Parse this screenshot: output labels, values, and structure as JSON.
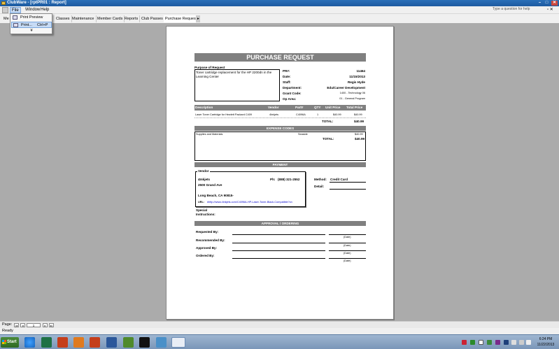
{
  "window": {
    "title": "ClubWare - [rptPR01 : Report]"
  },
  "menu": {
    "items": [
      "File",
      "Window",
      "Help"
    ],
    "help_placeholder": "Type a question for help"
  },
  "file_menu": {
    "print_preview": "Print Preview",
    "print": "Print...",
    "print_shortcut": "Ctrl+P",
    "more": "¥"
  },
  "tabs": [
    "Me",
    "Classes",
    "Maintenance",
    "Member Cards",
    "Reports",
    "Club Passes",
    "Purchase Request"
  ],
  "report": {
    "title": "PURCHASE REQUEST",
    "purpose_label": "Purpose of Request",
    "purpose_text": "Toner cartridge replacement for the HP 2200dn in the Learning Center",
    "fields": [
      {
        "label": "PR#:",
        "value": "11464"
      },
      {
        "label": "Date:",
        "value": "11/15/2013"
      },
      {
        "label": "Staff:",
        "value": "Regis Hyde"
      },
      {
        "label": "Department:",
        "value": "Edu/Career Development"
      },
      {
        "label": "Grant Code:",
        "value": "1400 - Technology 06"
      },
      {
        "label": "Op Area:",
        "value": "01 - General Program"
      }
    ],
    "item_headers": [
      "Description",
      "Vendor",
      "Part#",
      "QTY",
      "Unit Price",
      "Total Price"
    ],
    "items": [
      {
        "description": "Laser Toner Cartridge for Hewlett Packard C409",
        "vendor": "4Inkjets",
        "part": "C4096A",
        "qty": "1",
        "unit": "$40.99",
        "total": "$40.99"
      }
    ],
    "item_total_label": "TOTAL:",
    "item_total": "$40.99",
    "expense_header": "EXPENSE CODES",
    "expense_rows": [
      {
        "code": "Supplies and Materials",
        "area": "Seaside",
        "amount": "$40.99"
      }
    ],
    "expense_total_label": "TOTAL:",
    "expense_total": "$40.99",
    "payment_header": "PAYMENT",
    "vendor_label": "Vendor",
    "vendor_name": "4Inkjets",
    "vendor_phone_label": "Ph:",
    "vendor_phone": "(888) 321-2552",
    "vendor_addr1": "2500 Grand Ave",
    "vendor_addr2": "Long Beach, CA  90815-",
    "vendor_url_label": "URL:",
    "vendor_url": "#http://www.4inkjets.com/C4096A-HP-Laser-Toner-Black-Compatible?cn",
    "method_label": "Method:",
    "method": "Credit Card",
    "detail_label": "Detail:",
    "special_label": "Special Instructions:",
    "approval_header": "APPROVAL / ORDERING",
    "approval_rows": [
      "Requested By:",
      "Recommended By:",
      "Approved By:",
      "Ordered By:"
    ],
    "date_caption": "(Date)"
  },
  "pagenav": {
    "label": "Page:",
    "page": "1"
  },
  "status": {
    "text": "Ready"
  },
  "taskbar": {
    "start": "Start",
    "time": "6:24 PM",
    "date": "11/22/2013"
  },
  "colors": {
    "section_bar": "#808080",
    "titlebar": "#1d5aa0",
    "taskbar": "#8aa4c4"
  }
}
